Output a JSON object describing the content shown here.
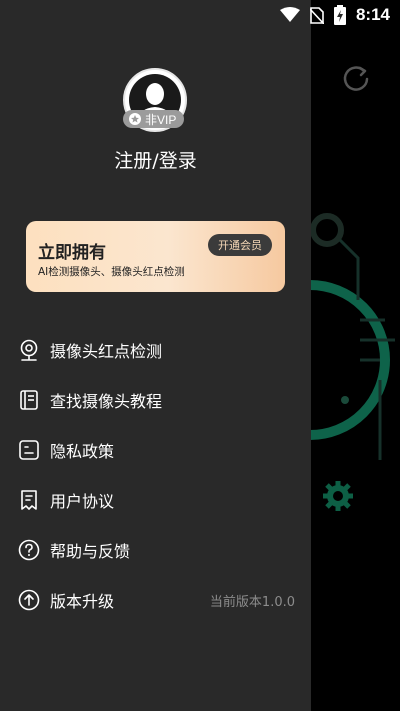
{
  "status_bar": {
    "time": "8:14"
  },
  "profile": {
    "vip_label": "非VIP",
    "login_text": "注册/登录"
  },
  "vip_card": {
    "title": "立即拥有",
    "subtitle": "AI检测摄像头、摄像头红点检测",
    "button": "开通会员"
  },
  "menu": [
    {
      "label": "摄像头红点检测",
      "icon": "camera-pin-icon"
    },
    {
      "label": "查找摄像头教程",
      "icon": "guide-book-icon"
    },
    {
      "label": "隐私政策",
      "icon": "privacy-doc-icon"
    },
    {
      "label": "用户协议",
      "icon": "agreement-doc-icon"
    },
    {
      "label": "帮助与反馈",
      "icon": "help-circle-icon"
    },
    {
      "label": "版本升级",
      "icon": "upgrade-arrow-icon",
      "extra": "当前版本1.0.0"
    }
  ],
  "colors": {
    "drawer_bg": "#292929",
    "accent_green": "#1db389",
    "vip_card_gradient_start": "#fde0bf",
    "vip_card_gradient_end": "#f6c9a0"
  }
}
